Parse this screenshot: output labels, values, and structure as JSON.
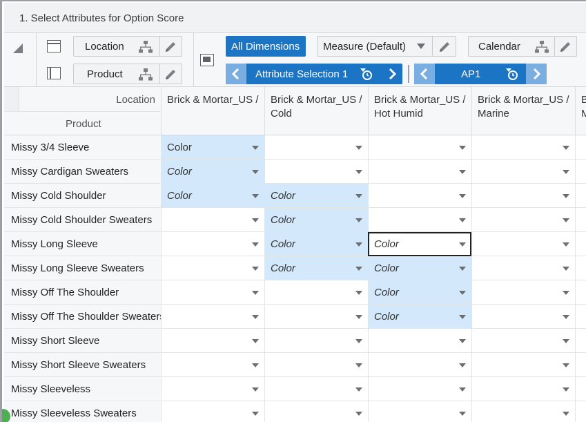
{
  "title": "1. Select Attributes for Option Score",
  "pivot": {
    "row_dims": [
      {
        "label": "Location"
      },
      {
        "label": "Product"
      }
    ],
    "all_dimensions_label": "All Dimensions",
    "measure_label": "Measure (Default)",
    "calendar_label": "Calendar",
    "attribute_selection_label": "Attribute Selection 1",
    "period_label": "AP1"
  },
  "grid": {
    "corner_location_label": "Location",
    "corner_product_label": "Product",
    "columns": [
      {
        "line1": "Brick & Mortar_US /",
        "line2": ""
      },
      {
        "line1": "Brick & Mortar_US /",
        "line2": "Cold"
      },
      {
        "line1": "Brick & Mortar_US /",
        "line2": "Hot Humid"
      },
      {
        "line1": "Brick & Mortar_US /",
        "line2": "Marine"
      },
      {
        "line1": "Br",
        "line2": "M"
      }
    ],
    "rows": [
      {
        "label": "Missy 3/4 Sleeve",
        "cells": [
          "Color",
          "",
          "",
          "",
          ""
        ]
      },
      {
        "label": "Missy Cardigan Sweaters",
        "cells": [
          "Color",
          "",
          "",
          "",
          ""
        ]
      },
      {
        "label": "Missy Cold Shoulder",
        "cells": [
          "Color",
          "Color",
          "",
          "",
          ""
        ]
      },
      {
        "label": "Missy Cold Shoulder Sweaters",
        "cells": [
          "",
          "Color",
          "",
          "",
          ""
        ]
      },
      {
        "label": "Missy Long Sleeve",
        "cells": [
          "",
          "Color",
          "Color",
          "",
          ""
        ]
      },
      {
        "label": "Missy Long Sleeve Sweaters",
        "cells": [
          "",
          "Color",
          "Color",
          "",
          ""
        ]
      },
      {
        "label": "Missy Off The Shoulder",
        "cells": [
          "",
          "",
          "Color",
          "",
          ""
        ]
      },
      {
        "label": "Missy Off The Shoulder Sweaters",
        "cells": [
          "",
          "",
          "Color",
          "",
          ""
        ]
      },
      {
        "label": "Missy Short Sleeve",
        "cells": [
          "",
          "",
          "",
          "",
          ""
        ]
      },
      {
        "label": "Missy Short Sleeve Sweaters",
        "cells": [
          "",
          "",
          "",
          "",
          ""
        ]
      },
      {
        "label": "Missy Sleeveless",
        "cells": [
          "",
          "",
          "",
          "",
          ""
        ]
      },
      {
        "label": "Missy Sleeveless Sweaters",
        "cells": [
          "",
          "",
          "",
          "",
          ""
        ]
      }
    ],
    "selected_cell": {
      "row": 4,
      "col": 2
    }
  },
  "colors": {
    "accent": "#1b74c4",
    "cell_highlight": "#d3e8fa"
  }
}
